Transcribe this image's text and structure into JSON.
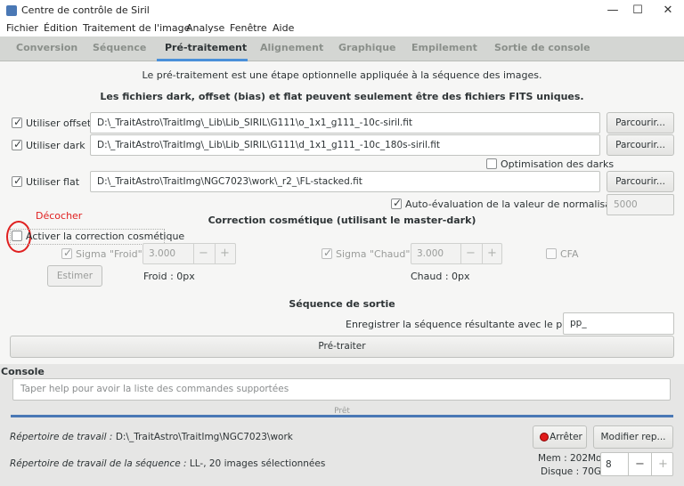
{
  "window": {
    "title": "Centre de contrôle de Siril",
    "minimize": "—",
    "maximize": "☐",
    "close": "✕"
  },
  "menu": [
    "Fichier",
    "Édition",
    "Traitement de l'image",
    "Analyse",
    "Fenêtre",
    "Aide"
  ],
  "tabs": [
    "Conversion",
    "Séquence",
    "Pré-traitement",
    "Alignement",
    "Graphique",
    "Empilement",
    "Sortie de console"
  ],
  "active_tab": "Pré-traitement",
  "preprocessing": {
    "intro": "Le pré-traitement est une étape optionnelle appliquée à la séquence des images.",
    "fits_note": "Les fichiers dark, offset (bias) et flat peuvent seulement être des fichiers FITS uniques.",
    "offset": {
      "label": "Utiliser offset",
      "checked": true,
      "path": "D:\\_TraitAstro\\TraitImg\\_Lib\\Lib_SIRIL\\G111\\o_1x1_g111_-10c-siril.fit",
      "browse": "Parcourir..."
    },
    "dark": {
      "label": "Utiliser dark",
      "checked": true,
      "path": "D:\\_TraitAstro\\TraitImg\\_Lib\\Lib_SIRIL\\G111\\d_1x1_g111_-10c_180s-siril.fit",
      "browse": "Parcourir..."
    },
    "dark_optimization": {
      "label": "Optimisation des darks",
      "checked": false
    },
    "flat": {
      "label": "Utiliser flat",
      "checked": true,
      "path": "D:\\_TraitAstro\\TraitImg\\NGC7023\\work\\_r2_\\FL-stacked.fit",
      "browse": "Parcourir..."
    },
    "auto_norm": {
      "label": "Auto-évaluation de la valeur de normalisation",
      "checked": true,
      "value": "5000"
    },
    "annotation": "Décocher",
    "cosmetic": {
      "title": "Correction cosmétique (utilisant le master-dark)",
      "activate_label": "Activer la correction cosmétique",
      "activate_checked": false,
      "sigma_cold": {
        "label": "Sigma \"Froid\" :",
        "checked": true,
        "value": "3.000"
      },
      "sigma_hot": {
        "label": "Sigma \"Chaud\" :",
        "checked": true,
        "value": "3.000"
      },
      "cfa": {
        "label": "CFA",
        "checked": false
      },
      "estimate_button": "Estimer",
      "cold_result": "Froid : 0px",
      "hot_result": "Chaud : 0px"
    },
    "output": {
      "title": "Séquence de sortie",
      "prefix_label": "Enregistrer la séquence résultante avec le préfixe :",
      "prefix_value": "pp_",
      "run_button": "Pré-traiter"
    }
  },
  "console": {
    "label": "Console",
    "placeholder": "Taper help pour avoir la liste des commandes supportées",
    "status": "Prêt",
    "workdir_label": "Répertoire de travail :",
    "workdir_value": "D:\\_TraitAstro\\TraitImg\\NGC7023\\work",
    "seq_label": "Répertoire de travail de la séquence :",
    "seq_value": "LL-, 20 images sélectionnées",
    "stop_button": "Arrêter",
    "change_dir_button": "Modifier rep...",
    "mem": "Mem : 202Mo",
    "disk": "Disque : 70G",
    "threads": "8"
  },
  "colors": {
    "accent": "#4a90d9",
    "annotation": "#e02020",
    "stop": "#e01b1b"
  }
}
